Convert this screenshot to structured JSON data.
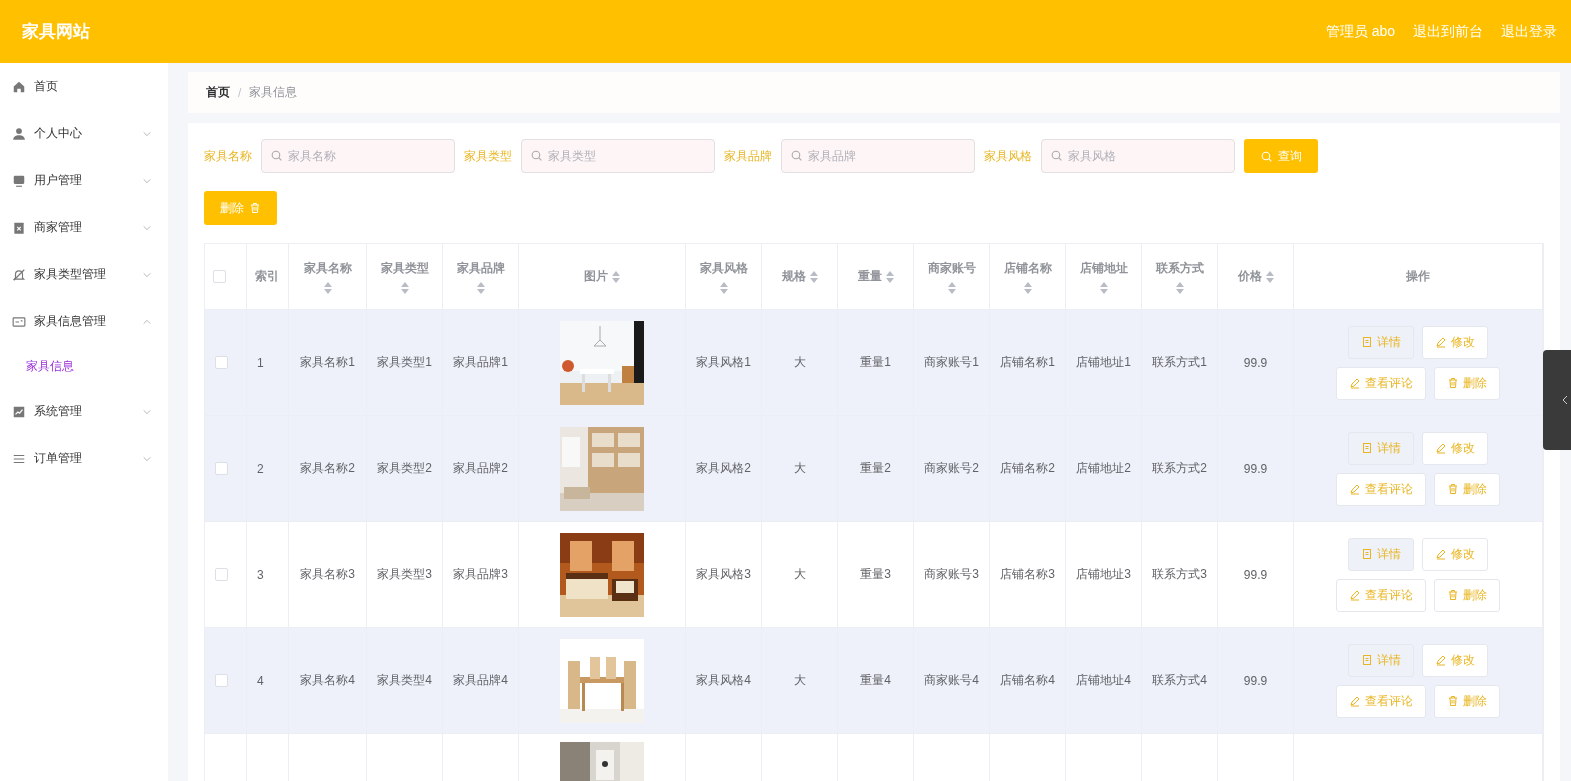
{
  "header": {
    "title": "家具网站",
    "links": [
      "管理员 abo",
      "退出到前台",
      "退出登录"
    ]
  },
  "sidebar": {
    "items": [
      {
        "label": "首页",
        "kind": "link"
      },
      {
        "label": "个人中心",
        "kind": "menu",
        "expanded": false
      },
      {
        "label": "用户管理",
        "kind": "menu",
        "expanded": false
      },
      {
        "label": "商家管理",
        "kind": "menu",
        "expanded": false
      },
      {
        "label": "家具类型管理",
        "kind": "menu",
        "expanded": false
      },
      {
        "label": "家具信息管理",
        "kind": "menu",
        "expanded": true,
        "children": [
          {
            "label": "家具信息",
            "selected": true
          }
        ]
      },
      {
        "label": "系统管理",
        "kind": "menu",
        "expanded": false
      },
      {
        "label": "订单管理",
        "kind": "menu",
        "expanded": false
      }
    ]
  },
  "breadcrumb": {
    "items": [
      "首页",
      "家具信息"
    ],
    "separator": "/"
  },
  "filters": [
    {
      "label": "家具名称",
      "placeholder": "家具名称"
    },
    {
      "label": "家具类型",
      "placeholder": "家具类型"
    },
    {
      "label": "家具品牌",
      "placeholder": "家具品牌"
    },
    {
      "label": "家具风格",
      "placeholder": "家具风格"
    }
  ],
  "search_button": "查询",
  "delete_button": "删除",
  "table": {
    "select_all": {
      "checked": false
    },
    "columns": [
      {
        "label": "索引",
        "kind": "text",
        "sortable": false
      },
      {
        "label": "家具名称",
        "kind": "text",
        "sortable": true
      },
      {
        "label": "家具类型",
        "kind": "text",
        "sortable": true
      },
      {
        "label": "家具品牌",
        "kind": "text",
        "sortable": true
      },
      {
        "label": "图片",
        "kind": "picture",
        "sortable": true
      },
      {
        "label": "家具风格",
        "kind": "text",
        "sortable": true
      },
      {
        "label": "规格",
        "kind": "text",
        "sortable": true
      },
      {
        "label": "重量",
        "kind": "text",
        "sortable": true
      },
      {
        "label": "商家账号",
        "kind": "text",
        "sortable": true
      },
      {
        "label": "店铺名称",
        "kind": "text",
        "sortable": true
      },
      {
        "label": "店铺地址",
        "kind": "text",
        "sortable": true
      },
      {
        "label": "联系方式",
        "kind": "text",
        "sortable": true
      },
      {
        "label": "价格",
        "kind": "text",
        "sortable": true
      },
      {
        "label": "操作",
        "kind": "actions",
        "sortable": false
      }
    ],
    "rows": [
      {
        "checked": false,
        "highlighted": true,
        "cells": [
          "1",
          "家具名称1",
          "家具类型1",
          "家具品牌1",
          "家具风格1",
          "大",
          "重量1",
          "商家账号1",
          "店铺名称1",
          "店铺地址1",
          "联系方式1",
          "99.9"
        ],
        "actions": [
          {
            "label": "详情",
            "kind": "detail"
          },
          {
            "label": "修改",
            "kind": "edit"
          },
          {
            "label": "查看评论",
            "kind": "comment"
          },
          {
            "label": "删除",
            "kind": "delete"
          }
        ]
      },
      {
        "checked": false,
        "highlighted": true,
        "cells": [
          "2",
          "家具名称2",
          "家具类型2",
          "家具品牌2",
          "家具风格2",
          "大",
          "重量2",
          "商家账号2",
          "店铺名称2",
          "店铺地址2",
          "联系方式2",
          "99.9"
        ],
        "actions": [
          {
            "label": "详情",
            "kind": "detail"
          },
          {
            "label": "修改",
            "kind": "edit"
          },
          {
            "label": "查看评论",
            "kind": "comment"
          },
          {
            "label": "删除",
            "kind": "delete"
          }
        ]
      },
      {
        "checked": false,
        "highlighted": false,
        "cells": [
          "3",
          "家具名称3",
          "家具类型3",
          "家具品牌3",
          "家具风格3",
          "大",
          "重量3",
          "商家账号3",
          "店铺名称3",
          "店铺地址3",
          "联系方式3",
          "99.9"
        ],
        "actions": [
          {
            "label": "详情",
            "kind": "detail"
          },
          {
            "label": "修改",
            "kind": "edit"
          },
          {
            "label": "查看评论",
            "kind": "comment"
          },
          {
            "label": "删除",
            "kind": "delete"
          }
        ]
      },
      {
        "checked": false,
        "highlighted": true,
        "cells": [
          "4",
          "家具名称4",
          "家具类型4",
          "家具品牌4",
          "家具风格4",
          "大",
          "重量4",
          "商家账号4",
          "店铺名称4",
          "店铺地址4",
          "联系方式4",
          "99.9"
        ],
        "actions": [
          {
            "label": "详情",
            "kind": "detail"
          },
          {
            "label": "修改",
            "kind": "edit"
          },
          {
            "label": "查看评论",
            "kind": "comment"
          },
          {
            "label": "删除",
            "kind": "delete"
          }
        ]
      },
      {
        "highlighted": false
      }
    ]
  }
}
